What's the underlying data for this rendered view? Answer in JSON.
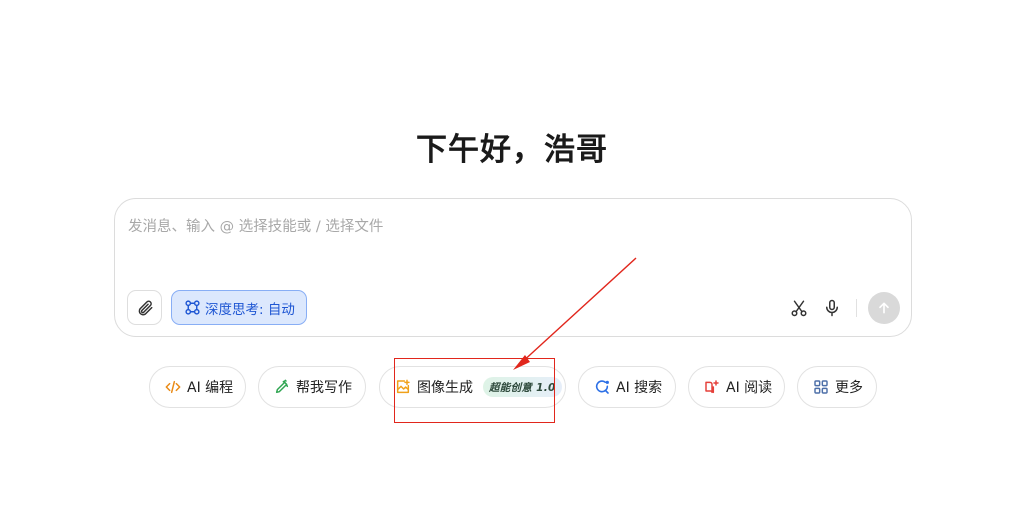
{
  "greeting": "下午好，浩哥",
  "composer": {
    "placeholder": "发消息、输入 @ 选择技能或 / 选择文件",
    "deep_think_label": "深度思考: 自动"
  },
  "chips": [
    {
      "label": "AI 编程",
      "icon": "code-icon"
    },
    {
      "label": "帮我写作",
      "icon": "pen-icon"
    },
    {
      "label": "图像生成",
      "icon": "image-gen-icon",
      "badge": "超能创意 1.0"
    },
    {
      "label": "AI 搜索",
      "icon": "search-icon"
    },
    {
      "label": "AI 阅读",
      "icon": "reader-icon"
    },
    {
      "label": "更多",
      "icon": "grid-icon"
    }
  ],
  "colors": {
    "accent": "#1e56d3",
    "annotation": "#e1261c",
    "code_icon": "#e98a15",
    "pen_icon": "#2fa551",
    "image_icon": "#f0a11a",
    "search_icon": "#2b6fe6",
    "reader_icon": "#e5403a",
    "more_icon": "#4d6fa8"
  }
}
